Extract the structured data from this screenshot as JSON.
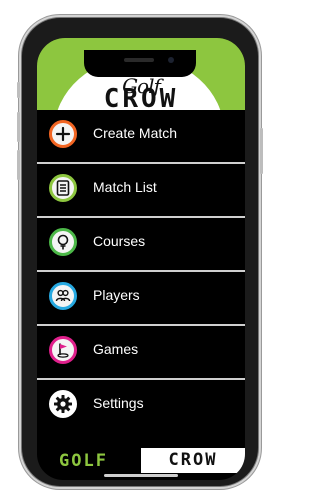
{
  "app": {
    "logo_top": "Golf",
    "logo_main": "CROW"
  },
  "menu": {
    "items": [
      {
        "label": "Create Match",
        "icon": "plus-icon",
        "color": "#f26522"
      },
      {
        "label": "Match List",
        "icon": "list-icon",
        "color": "#8dc63f"
      },
      {
        "label": "Courses",
        "icon": "golf-ball-tee-icon",
        "color": "#4cb848"
      },
      {
        "label": "Players",
        "icon": "players-icon",
        "color": "#27a9e1"
      },
      {
        "label": "Games",
        "icon": "flag-icon",
        "color": "#e0208c"
      },
      {
        "label": "Settings",
        "icon": "gear-icon",
        "color": "#ffffff"
      }
    ]
  },
  "footer": {
    "left": "GOLF",
    "right": "CROW"
  },
  "colors": {
    "brand_green": "#8dc63f",
    "background": "#000000"
  }
}
